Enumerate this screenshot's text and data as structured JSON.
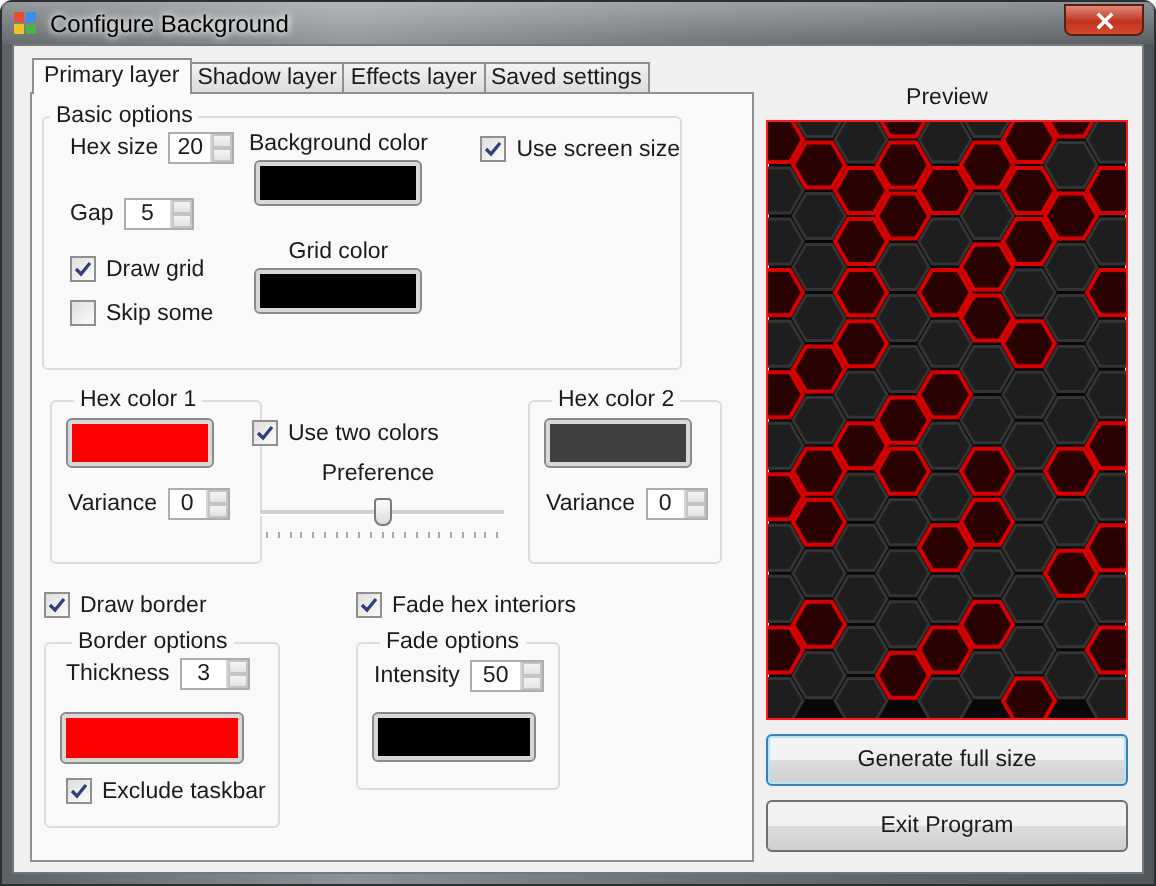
{
  "window": {
    "title": "Configure Background"
  },
  "tabs": [
    {
      "label": "Primary layer",
      "selected": true
    },
    {
      "label": "Shadow layer",
      "selected": false
    },
    {
      "label": "Effects layer",
      "selected": false
    },
    {
      "label": "Saved settings",
      "selected": false
    }
  ],
  "basic_options": {
    "title": "Basic options",
    "hex_size": {
      "label": "Hex size",
      "value": "20"
    },
    "gap": {
      "label": "Gap",
      "value": "5"
    },
    "draw_grid": {
      "label": "Draw grid",
      "checked": true
    },
    "skip_some": {
      "label": "Skip some",
      "checked": false
    },
    "background_color": {
      "label": "Background color",
      "color": "#000000"
    },
    "grid_color": {
      "label": "Grid color",
      "color": "#000000"
    },
    "use_screen_size": {
      "label": "Use screen size",
      "checked": true
    }
  },
  "hex_color_1": {
    "title": "Hex color 1",
    "color": "#ff0000",
    "variance": {
      "label": "Variance",
      "value": "0"
    }
  },
  "use_two_colors": {
    "label": "Use two colors",
    "checked": true
  },
  "preference": {
    "label": "Preference",
    "level": 0.5
  },
  "hex_color_2": {
    "title": "Hex color 2",
    "color": "#404040",
    "variance": {
      "label": "Variance",
      "value": "0"
    }
  },
  "draw_border": {
    "label": "Draw border",
    "checked": true
  },
  "border_options": {
    "title": "Border options",
    "thickness": {
      "label": "Thickness",
      "value": "3"
    },
    "color": "#ff0000",
    "exclude_taskbar": {
      "label": "Exclude taskbar",
      "checked": true
    }
  },
  "fade_hex_interiors": {
    "label": "Fade hex interiors",
    "checked": true
  },
  "fade_options": {
    "title": "Fade options",
    "intensity": {
      "label": "Intensity",
      "value": "50"
    },
    "color": "#000000"
  },
  "preview": {
    "title": "Preview"
  },
  "buttons": [
    {
      "label": "Generate full size",
      "focused": true
    },
    {
      "label": "Exit Program",
      "focused": false
    }
  ]
}
